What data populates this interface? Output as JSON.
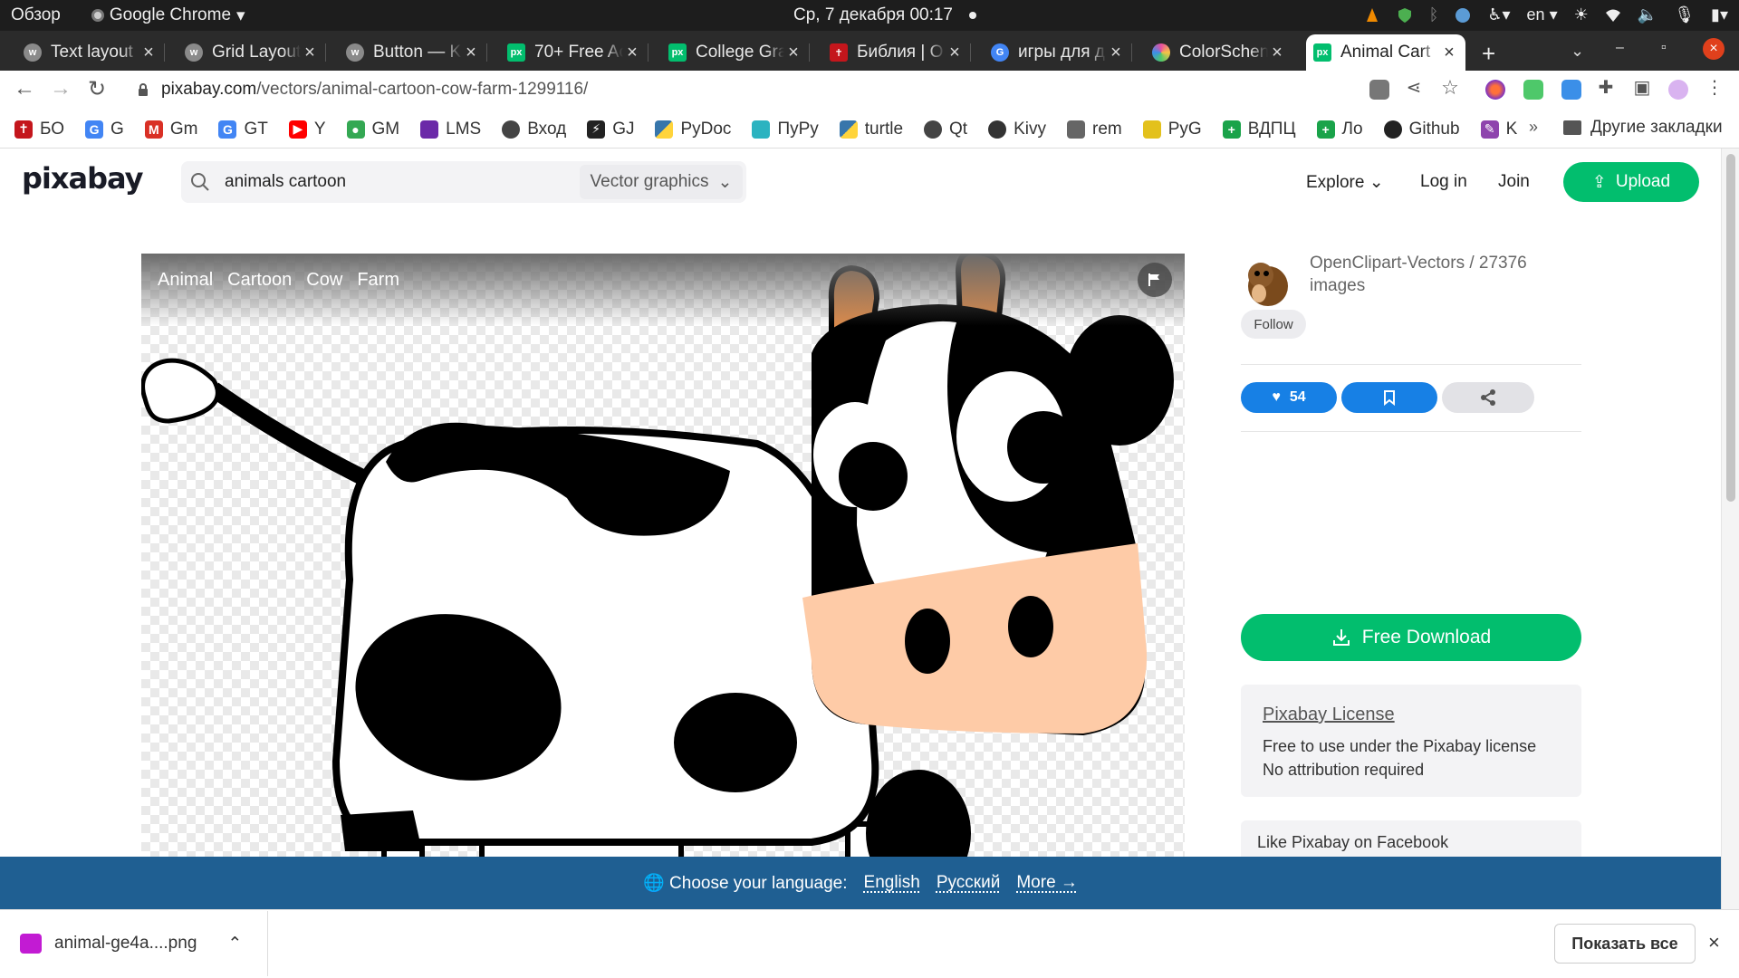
{
  "os": {
    "activities": "Обзор",
    "app_name": "Google Chrome",
    "clock": "Ср, 7 декабря  00:17",
    "lang_indicator": "en"
  },
  "tabs": [
    {
      "label": "Text layout",
      "favicon": "globe-icon",
      "color": "#8a8a8a"
    },
    {
      "label": "Grid Layout",
      "favicon": "globe-icon",
      "color": "#8a8a8a"
    },
    {
      "label": "Button — K",
      "favicon": "globe-icon",
      "color": "#8a8a8a"
    },
    {
      "label": "70+ Free Ac",
      "favicon": "pixabay-icon",
      "color": "#02be6e"
    },
    {
      "label": "College Gra",
      "favicon": "pixabay-icon",
      "color": "#02be6e"
    },
    {
      "label": "Библия | О",
      "favicon": "bible-icon",
      "color": "#c4161c"
    },
    {
      "label": "игры для д",
      "favicon": "google-icon",
      "color": "#4285f4"
    },
    {
      "label": "ColorSchen",
      "favicon": "colorwheel-icon",
      "color": "#e94da0"
    },
    {
      "label": "Animal Cart",
      "favicon": "pixabay-icon",
      "color": "#02be6e"
    }
  ],
  "address": {
    "host": "pixabay.com",
    "path": "/vectors/animal-cartoon-cow-farm-1299116/"
  },
  "bookmarks": [
    {
      "label": "БО",
      "icon": "bible-icon",
      "color": "#c4161c"
    },
    {
      "label": "G",
      "icon": "google-icon",
      "color": "#4285f4"
    },
    {
      "label": "Gm",
      "icon": "gmail-icon",
      "color": "#d93025"
    },
    {
      "label": "GT",
      "icon": "translate-icon",
      "color": "#4285f4"
    },
    {
      "label": "Y",
      "icon": "youtube-icon",
      "color": "#ff0000"
    },
    {
      "label": "GM",
      "icon": "maps-icon",
      "color": "#34a853"
    },
    {
      "label": "LMS",
      "icon": "lms-icon",
      "color": "#6b2aa8"
    },
    {
      "label": "Вход",
      "icon": "globe-icon",
      "color": "#444444"
    },
    {
      "label": "GJ",
      "icon": "gj-icon",
      "color": "#222222"
    },
    {
      "label": "PyDoc",
      "icon": "python-icon",
      "color": "#3776ab"
    },
    {
      "label": "ПуРу",
      "icon": "pypu-icon",
      "color": "#2bb3c0"
    },
    {
      "label": "turtle",
      "icon": "python-icon",
      "color": "#3776ab"
    },
    {
      "label": "Qt",
      "icon": "globe-icon",
      "color": "#444444"
    },
    {
      "label": "Kivy",
      "icon": "kivy-icon",
      "color": "#333333"
    },
    {
      "label": "rem",
      "icon": "rem-icon",
      "color": "#666666"
    },
    {
      "label": "PyG",
      "icon": "pygame-icon",
      "color": "#e3c11c"
    },
    {
      "label": "ВДПЦ",
      "icon": "plus-icon",
      "color": "#1aa34a"
    },
    {
      "label": "Ло",
      "icon": "plus-icon",
      "color": "#1aa34a"
    },
    {
      "label": "Github",
      "icon": "github-icon",
      "color": "#222222"
    },
    {
      "label": "K",
      "icon": "pen-icon",
      "color": "#8e44ad"
    }
  ],
  "bookmarks_more": "»",
  "bookmarks_other": "Другие закладки",
  "site": {
    "logo": "pixabay",
    "search_value": "animals cartoon",
    "search_type": "Vector graphics",
    "nav": {
      "explore": "Explore",
      "login": "Log in",
      "join": "Join",
      "upload": "Upload"
    }
  },
  "image": {
    "tags": [
      "Animal",
      "Cartoon",
      "Cow",
      "Farm"
    ]
  },
  "sidebar": {
    "author": "OpenClipart-Vectors / 27376 images",
    "follow": "Follow",
    "likes": "54",
    "download": "Free Download",
    "license_title": "Pixabay License",
    "license_lines": [
      "Free to use under the Pixabay license",
      "No attribution required"
    ],
    "facebook": "Like Pixabay on Facebook"
  },
  "language_bar": {
    "prompt": "Choose your language:",
    "options": [
      "English",
      "Русский",
      "More →"
    ]
  },
  "downloads": {
    "file": "animal-ge4a....png",
    "show_all": "Показать все"
  }
}
